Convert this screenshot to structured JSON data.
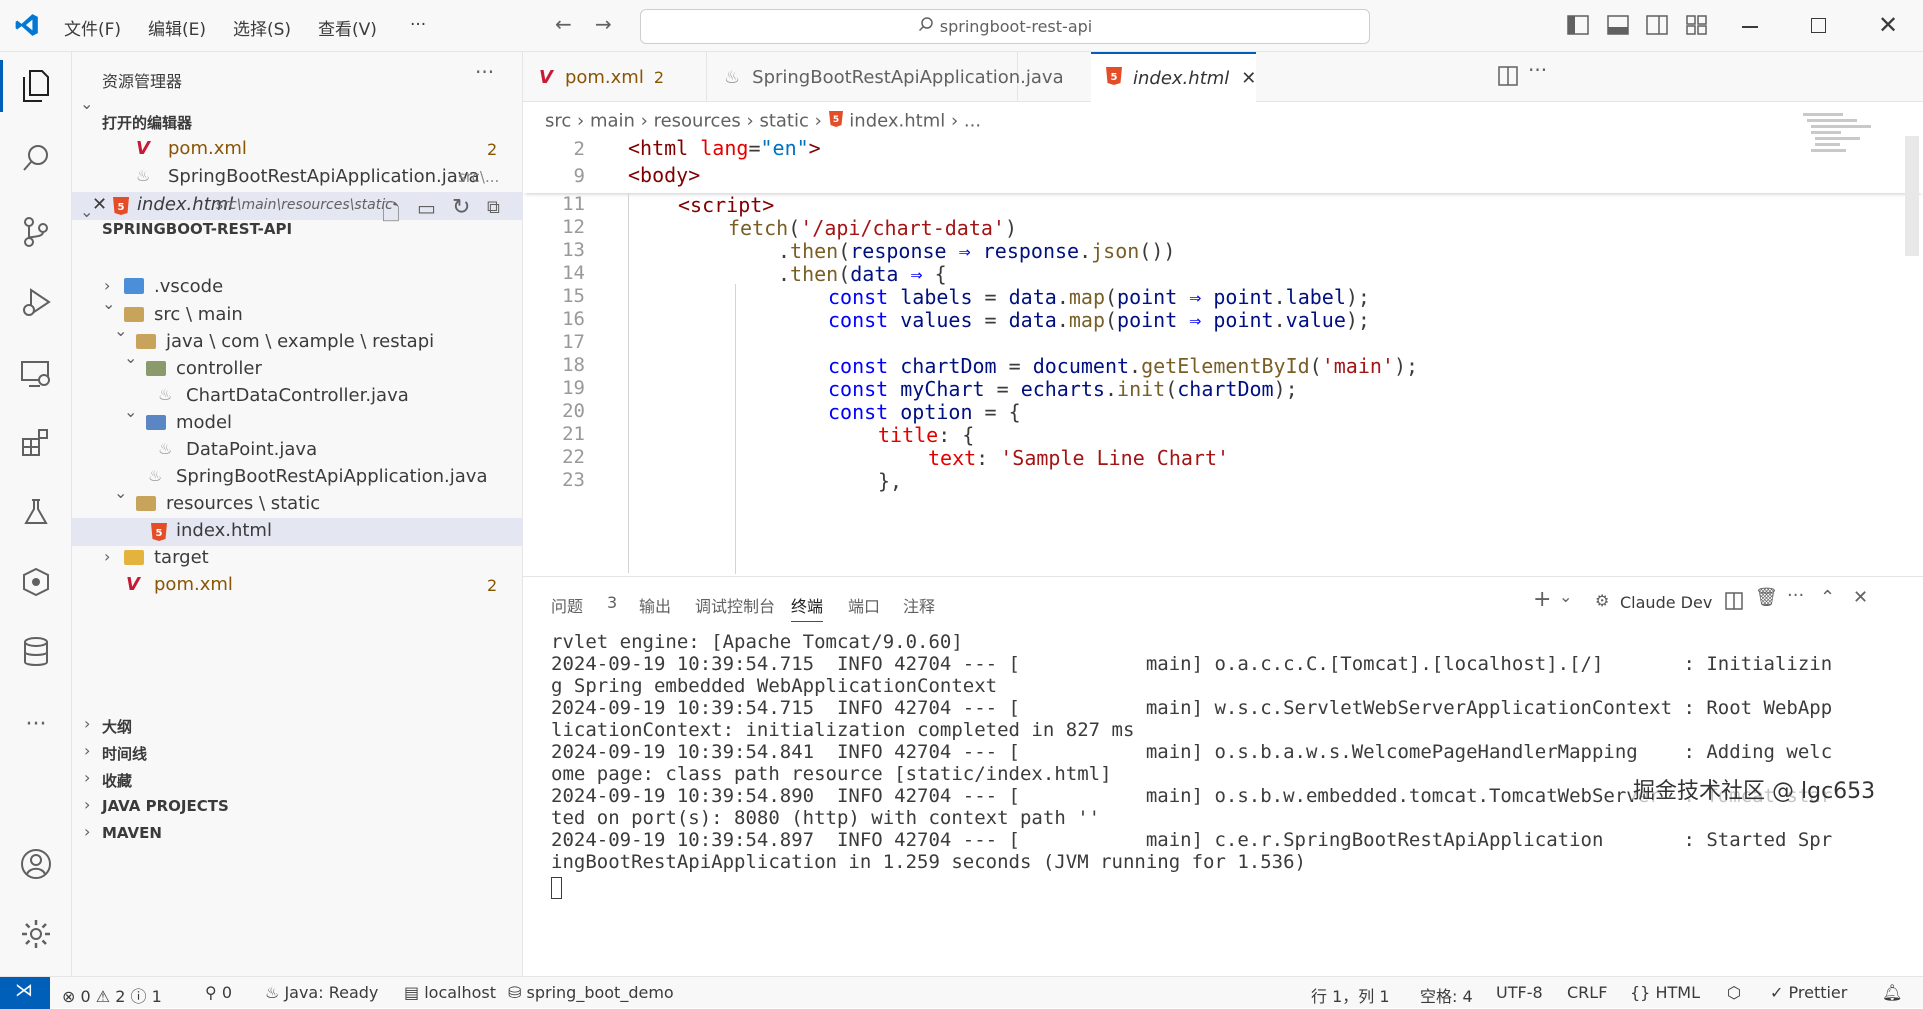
{
  "titlebar": {
    "menu": [
      "文件(F)",
      "编辑(E)",
      "选择(S)",
      "查看(V)",
      "···"
    ],
    "search": "springboot-rest-api"
  },
  "sidebar": {
    "title": "资源管理器",
    "open_editors": "打开的编辑器",
    "open_files": [
      {
        "name": "pom.xml",
        "badge": "2"
      },
      {
        "name": "SpringBootRestApiApplication.java",
        "path": "src\\..."
      },
      {
        "name": "index.html",
        "path": "src\\main\\resources\\static"
      }
    ],
    "project": "SPRINGBOOT-REST-API",
    "tree": [
      ".vscode",
      "src \\ main",
      "java \\ com \\ example \\ restapi",
      "controller",
      "ChartDataController.java",
      "model",
      "DataPoint.java",
      "SpringBootRestApiApplication.java",
      "resources \\ static",
      "index.html",
      "target",
      "pom.xml"
    ],
    "pom_badge": "2",
    "bottom": [
      "大纲",
      "时间线",
      "收藏",
      "JAVA PROJECTS",
      "MAVEN"
    ]
  },
  "tabs": [
    {
      "name": "pom.xml",
      "badge": "2"
    },
    {
      "name": "SpringBootRestApiApplication.java"
    },
    {
      "name": "index.html"
    }
  ],
  "breadcrumb": [
    "src",
    "main",
    "resources",
    "static",
    "index.html",
    "..."
  ],
  "editor": {
    "line_numbers": [
      "2",
      "9",
      "11",
      "12",
      "13",
      "14",
      "15",
      "16",
      "17",
      "18",
      "19",
      "20",
      "21",
      "22",
      "23"
    ]
  },
  "panel": {
    "tabs": [
      "问题",
      "输出",
      "调试控制台",
      "终端",
      "端口",
      "注释"
    ],
    "problems_count": "3",
    "claude": "Claude Dev",
    "terminal": [
      "rvlet engine: [Apache Tomcat/9.0.60]",
      "2024-09-19 10:39:54.715  INFO 42704 --- [           main] o.a.c.c.C.[Tomcat].[localhost].[/]       : Initializin",
      "g Spring embedded WebApplicationContext",
      "2024-09-19 10:39:54.715  INFO 42704 --- [           main] w.s.c.ServletWebServerApplicationContext : Root WebApp",
      "licationContext: initialization completed in 827 ms",
      "2024-09-19 10:39:54.841  INFO 42704 --- [           main] o.s.b.a.w.s.WelcomePageHandlerMapping    : Adding welc",
      "ome page: class path resource [static/index.html]",
      "2024-09-19 10:39:54.890  INFO 42704 --- [           main] o.s.b.w.embedded.tomcat.TomcatWebServer  : Tomcat star",
      "ted on port(s): 8080 (http) with context path ''",
      "2024-09-19 10:39:54.897  INFO 42704 --- [           main] c.e.r.SpringBootRestApiApplication       : Started Spr",
      "ingBootRestApiApplication in 1.259 seconds (JVM running for 1.536)"
    ]
  },
  "watermark": "掘金技术社区 @ lgc653",
  "status": {
    "errors": "0",
    "warnings": "2",
    "info": "1",
    "ports": "0",
    "java": "Java: Ready",
    "db": "localhost",
    "schema": "spring_boot_demo",
    "position": "行 1，列 1",
    "spaces": "空格: 4",
    "encoding": "UTF-8",
    "eol": "CRLF",
    "lang": "HTML",
    "prettier": "Prettier"
  },
  "colors": {
    "accent": "#007acc",
    "html_icon": "#e44d26",
    "maven": "#c71a36",
    "modified": "#895503"
  }
}
